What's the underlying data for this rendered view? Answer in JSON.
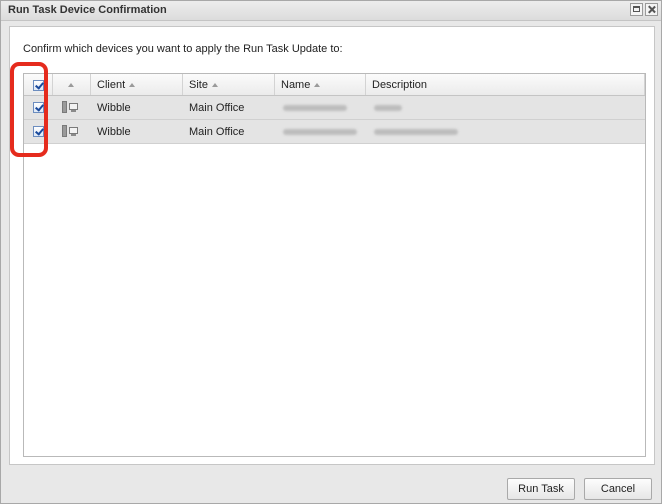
{
  "window": {
    "title": "Run Task Device Confirmation"
  },
  "prompt": "Confirm which devices you want to apply the Run Task Update to:",
  "table": {
    "columns": [
      "Client",
      "Site",
      "Name",
      "Description"
    ],
    "select_all_checked": true,
    "rows": [
      {
        "checked": true,
        "client": "Wibble",
        "site": "Main Office",
        "name": "",
        "description": ""
      },
      {
        "checked": true,
        "client": "Wibble",
        "site": "Main Office",
        "name": "",
        "description": ""
      }
    ]
  },
  "buttons": {
    "run_task": "Run Task",
    "cancel": "Cancel"
  },
  "icons": {
    "device": "desktop-computer-icon",
    "sort": "sort-ascending-arrow-icon"
  },
  "colors": {
    "highlight": "#e52b1d",
    "checkbox_check": "#1a4a9c"
  }
}
